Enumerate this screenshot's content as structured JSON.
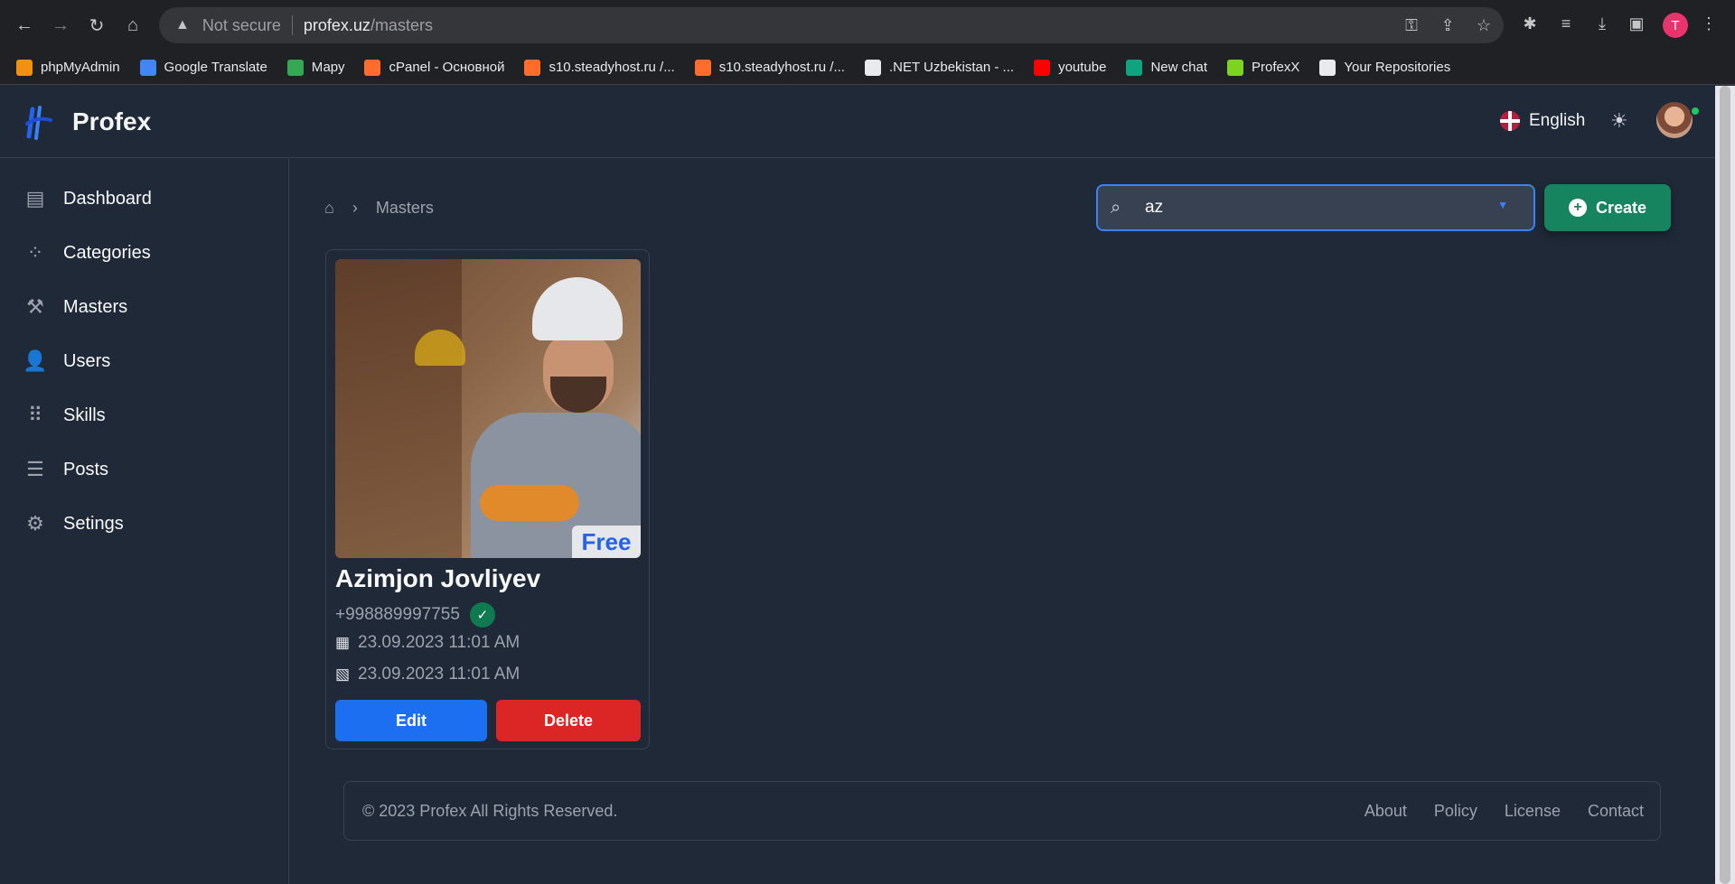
{
  "browser": {
    "security_label": "Not secure",
    "url_host": "profex.uz",
    "url_path": "/masters",
    "profile_initial": "T",
    "bookmarks": [
      {
        "label": "phpMyAdmin",
        "color": "#f29111"
      },
      {
        "label": "Google Translate",
        "color": "#4285f4"
      },
      {
        "label": "Мару",
        "color": "#34a853"
      },
      {
        "label": "cPanel - Основной",
        "color": "#ff6c2c"
      },
      {
        "label": "s10.steadyhost.ru /...",
        "color": "#ff6c2c"
      },
      {
        "label": "s10.steadyhost.ru /...",
        "color": "#ff6c2c"
      },
      {
        "label": ".NET Uzbekistan - ...",
        "color": "#e8eaed"
      },
      {
        "label": "youtube",
        "color": "#ff0000"
      },
      {
        "label": "New chat",
        "color": "#10a37f"
      },
      {
        "label": "ProfexX",
        "color": "#7ed321"
      },
      {
        "label": "Your Repositories",
        "color": "#e8eaed"
      }
    ]
  },
  "header": {
    "brand": "Profex",
    "language": "English"
  },
  "sidebar": {
    "items": [
      {
        "label": "Dashboard",
        "icon": "dashboard-icon"
      },
      {
        "label": "Categories",
        "icon": "categories-icon"
      },
      {
        "label": "Masters",
        "icon": "hammer-icon"
      },
      {
        "label": "Users",
        "icon": "user-plus-icon"
      },
      {
        "label": "Skills",
        "icon": "skills-icon"
      },
      {
        "label": "Posts",
        "icon": "list-icon"
      },
      {
        "label": "Setings",
        "icon": "gear-icon"
      }
    ]
  },
  "breadcrumb": {
    "current": "Masters"
  },
  "search": {
    "value": "az"
  },
  "toolbar": {
    "create_label": "Create"
  },
  "master_card": {
    "badge": "Free",
    "name": "Azimjon Jovliyev",
    "phone": "+998889997755",
    "created": "23.09.2023 11:01 AM",
    "updated": "23.09.2023 11:01 AM",
    "edit_label": "Edit",
    "delete_label": "Delete"
  },
  "footer": {
    "copyright": "© 2023 Profex All Rights Reserved.",
    "links": [
      "About",
      "Policy",
      "License",
      "Contact"
    ]
  },
  "colors": {
    "accent": "#3b82f6",
    "create": "#16855f",
    "edit": "#1d6ff2",
    "delete": "#dc2626"
  }
}
